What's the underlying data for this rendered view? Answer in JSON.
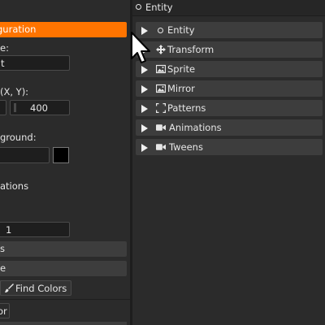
{
  "left": {
    "config_label": "guration",
    "name_label": "e:",
    "name_value": "t",
    "size_label": "(X, Y):",
    "size_y": "400",
    "background_label": "ground:",
    "animations_label": "ations",
    "number_value": "1",
    "button1_label": "s",
    "button2_label": "e",
    "find_colors_label": "Find Colors",
    "bottom_label": "or"
  },
  "right": {
    "header_title": "Entity",
    "sections": [
      {
        "label": "Entity",
        "icon": "circle-icon"
      },
      {
        "label": "Transform",
        "icon": "move-icon"
      },
      {
        "label": "Sprite",
        "icon": "image-icon"
      },
      {
        "label": "Mirror",
        "icon": "image-icon"
      },
      {
        "label": "Patterns",
        "icon": "frame-icon"
      },
      {
        "label": "Animations",
        "icon": "video-icon"
      },
      {
        "label": "Tweens",
        "icon": "video-icon"
      }
    ]
  },
  "colors": {
    "accent": "#ff7400",
    "panel": "#2b2b2b",
    "section": "#3d3d3d",
    "swatch": "#000000"
  }
}
